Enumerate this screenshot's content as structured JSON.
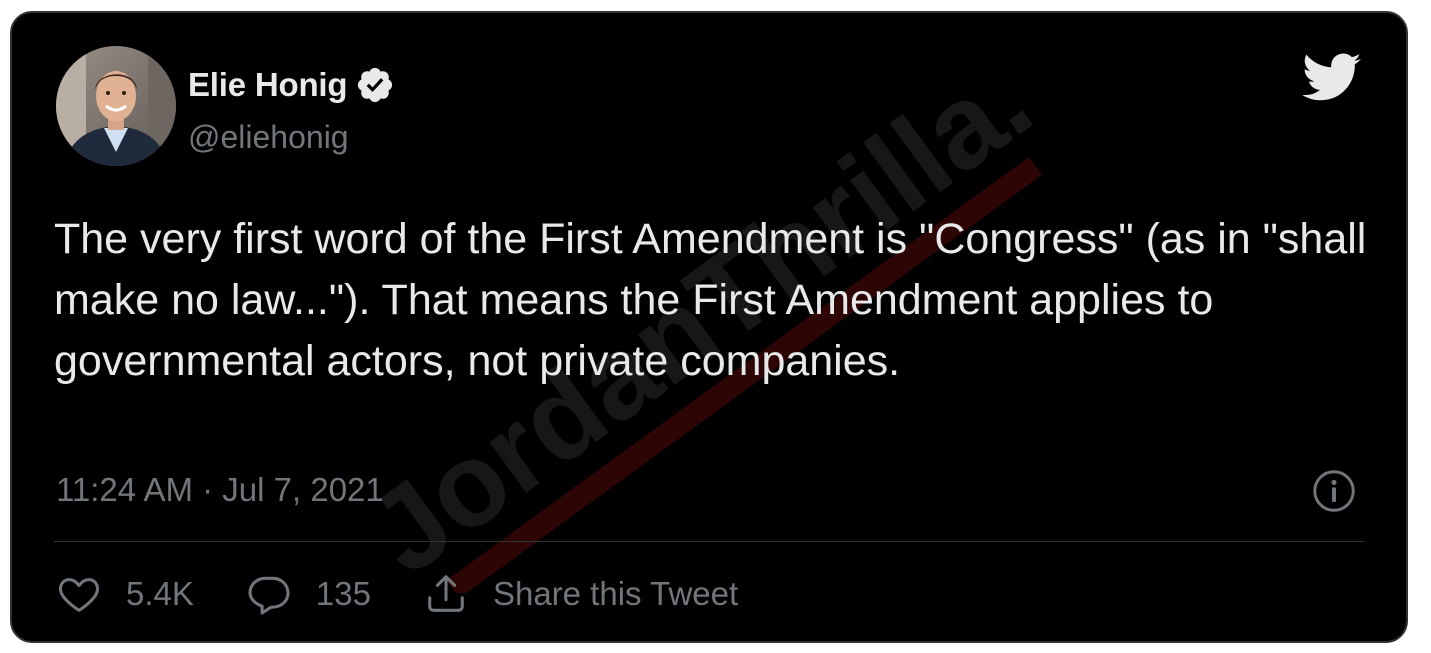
{
  "tweet": {
    "author": {
      "display_name": "Elie Honig",
      "handle": "@eliehonig",
      "verified": true
    },
    "text": "The very first word of the First Amendment is \"Congress\" (as in \"shall make no law...\"). That means the First Amendment applies to governmental actors, not private companies.",
    "timestamp": "11:24 AM · Jul 7, 2021",
    "actions": {
      "like_count": "5.4K",
      "reply_count": "135",
      "share_label": "Share this Tweet"
    }
  },
  "watermark": {
    "text": "JordanThrilla."
  },
  "icons": {
    "brand": "twitter-bird-icon",
    "verified": "verified-badge-icon",
    "info": "info-icon",
    "like": "heart-icon",
    "reply": "speech-bubble-icon",
    "share": "share-upload-icon"
  },
  "colors": {
    "background": "#000000",
    "primary_text": "#e7e9ea",
    "secondary_text": "#71767b",
    "divider": "#2f3336"
  }
}
